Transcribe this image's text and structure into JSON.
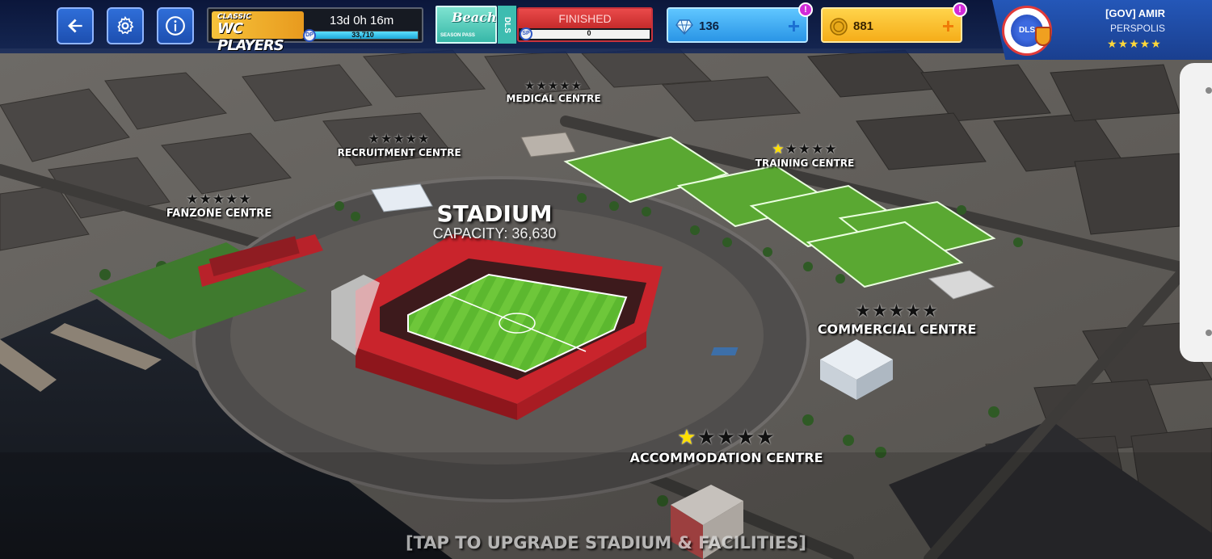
{
  "toolbar": {
    "back_icon": "back-arrow-icon",
    "settings_icon": "gear-icon",
    "info_icon": "info-icon"
  },
  "event": {
    "logo_small": "CLASSIC",
    "logo_big": "WC PLAYERS",
    "time_left": "13d 0h 16m",
    "points_badge": "DP",
    "points": "33,710",
    "progress": 1.0
  },
  "season": {
    "title": "Beach",
    "subtitle": "SEASON PASS",
    "side_label": "DLS",
    "status": "FINISHED",
    "points_badge": "SP",
    "points": "0"
  },
  "currency": {
    "gems": "136",
    "coins": "881",
    "alert_label": "!"
  },
  "profile": {
    "name": "[GOV] AMIR",
    "team": "PERSPOLIS",
    "crest_label": "DLS",
    "stars": "★★★★★"
  },
  "stadium": {
    "title": "STADIUM",
    "capacity": "CAPACITY: 36,630"
  },
  "facilities": {
    "medical": {
      "name": "MEDICAL CENTRE",
      "stars": 0
    },
    "recruitment": {
      "name": "RECRUITMENT CENTRE",
      "stars": 0
    },
    "training": {
      "name": "TRAINING CENTRE",
      "stars": 1
    },
    "fanzone": {
      "name": "FANZONE CENTRE",
      "stars": 0
    },
    "commercial": {
      "name": "COMMERCIAL CENTRE",
      "stars": 0
    },
    "accommodation": {
      "name": "ACCOMMODATION CENTRE",
      "stars": 1
    }
  },
  "max_stars": 5,
  "footer_hint": "[TAP TO UPGRADE STADIUM & FACILITIES]",
  "colors": {
    "stadium_red": "#d8262e",
    "pitch_green": "#4fae2a",
    "star_on": "#ffe000",
    "gems_blue": "#2a95e6",
    "coins_gold": "#f5ad19"
  }
}
